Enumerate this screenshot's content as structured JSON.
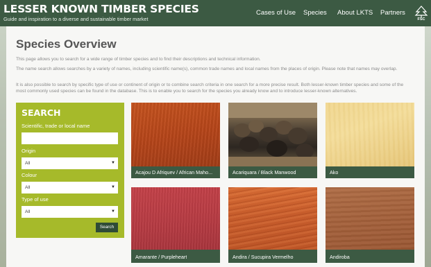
{
  "header": {
    "brand_title": "LESSER KNOWN TIMBER SPECIES",
    "brand_subtitle": "Guide and inspiration to a diverse and sustainable timber market",
    "nav": [
      "Cases of Use",
      "Species",
      "About LKTS",
      "Partners"
    ],
    "fsc_label": "FSC",
    "fsc_icon": "fsc-tree-logo"
  },
  "page": {
    "title": "Species Overview",
    "intro_1": "This page allows you to search for a wide range of timber species and to find their descriptions and technical information.",
    "intro_2": "The name search allows searches by a variety of names, including scientific name(s), common trade names and local names from the places of origin. Please note that names may overlap.",
    "intro_3": "It is also possible to search by specific type of use or continent of origin or to combine search criteria in one search for a more precise result. Both lesser-known timber species and some of the most commonly used species can be found in the database. This is to enable you to search for the species you already know and to introduce lesser-known alternatives."
  },
  "search": {
    "title": "SEARCH",
    "name_label": "Scientific, trade or local name",
    "name_value": "",
    "origin_label": "Origin",
    "origin_value": "All",
    "colour_label": "Colour",
    "colour_value": "All",
    "use_label": "Type of use",
    "use_value": "All",
    "button": "Search"
  },
  "species": [
    {
      "name": "Acajou D Afriquev / African Maho...",
      "texture": "mahogany-wood"
    },
    {
      "name": "Acariquara / Black Manwood",
      "texture": "log-pile-photo"
    },
    {
      "name": "Ako",
      "texture": "pale-yellow-wood"
    },
    {
      "name": "Amarante / Purpleheart",
      "texture": "purpleheart-wood"
    },
    {
      "name": "Andira / Sucupira Vermelho",
      "texture": "orange-grain-wood"
    },
    {
      "name": "Andiroba",
      "texture": "brown-wood"
    }
  ],
  "colors": {
    "header_green": "#3c5a43",
    "search_green": "#a6ba2a",
    "button_green": "#2f4b36"
  }
}
